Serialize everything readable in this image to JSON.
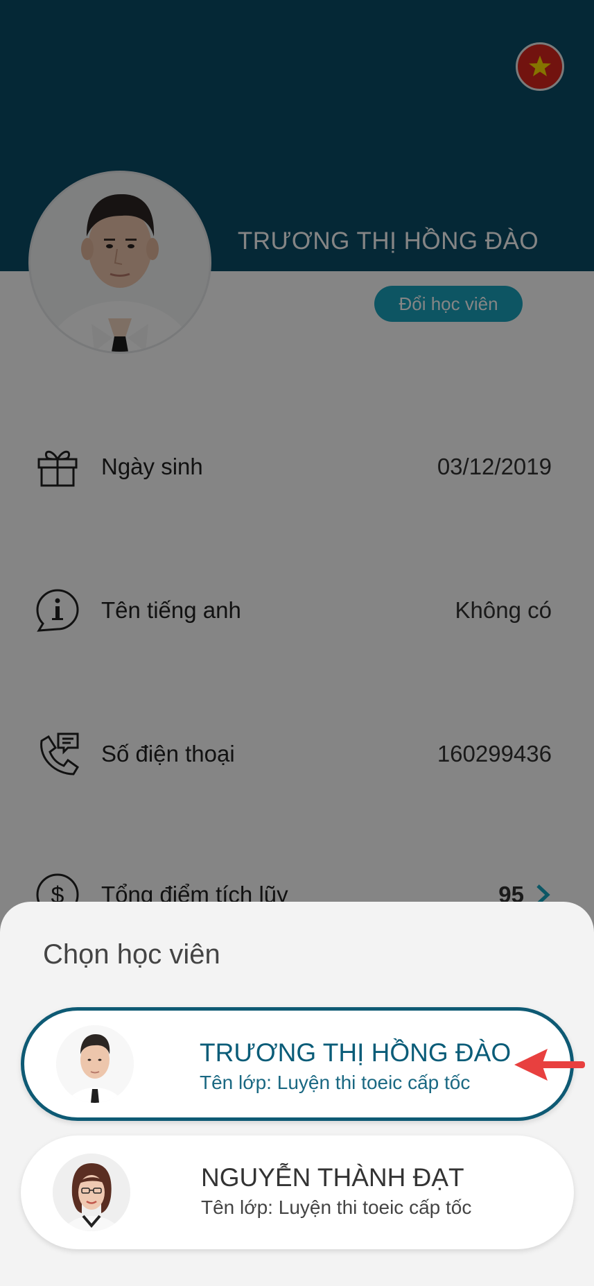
{
  "header": {
    "flag_icon": "vietnam-flag-icon",
    "student_name": "TRƯƠNG THỊ HỒNG ĐÀO",
    "switch_button_label": "Đổi học viên"
  },
  "info_rows": [
    {
      "icon": "gift-icon",
      "label": "Ngày sinh",
      "value": "03/12/2019"
    },
    {
      "icon": "info-chat-icon",
      "label": "Tên tiếng anh",
      "value": "Không có"
    },
    {
      "icon": "phone-message-icon",
      "label": "Số điện thoại",
      "value": "160299436"
    },
    {
      "icon": "dollar-icon",
      "label": "Tổng điểm tích lũy",
      "value": "95"
    }
  ],
  "sheet": {
    "title": "Chọn học viên",
    "students": [
      {
        "name": "TRƯƠNG THỊ HỒNG ĐÀO",
        "class": "Tên lớp: Luyện thi toeic cấp tốc",
        "selected": true
      },
      {
        "name": "NGUYỄN THÀNH ĐẠT",
        "class": "Tên lớp: Luyện thi toeic cấp tốc",
        "selected": false
      }
    ]
  },
  "colors": {
    "header_bg": "#0a4d68",
    "accent": "#1aa4be",
    "selected_border": "#0e5a74",
    "arrow": "#e8403f"
  }
}
